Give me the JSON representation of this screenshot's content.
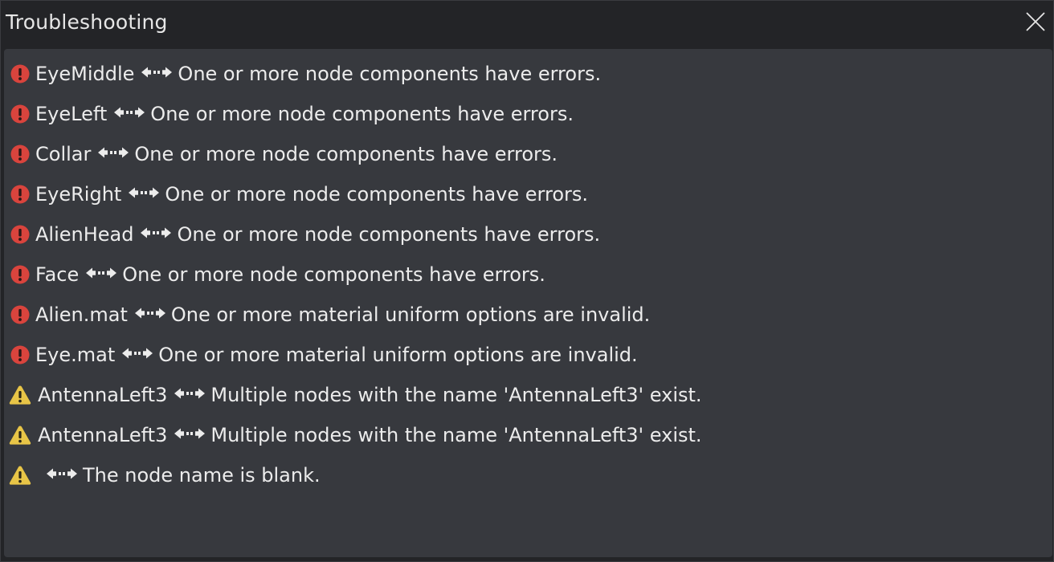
{
  "window": {
    "title": "Troubleshooting",
    "close_icon": "close-icon"
  },
  "colors": {
    "error": "#d9443d",
    "warning": "#e8c547",
    "panel_bg": "#37393e",
    "window_bg": "#232427",
    "text": "#ececec"
  },
  "issues": [
    {
      "severity": "error",
      "icon": "error-icon",
      "node": "EyeMiddle",
      "message": "One or more node components have errors."
    },
    {
      "severity": "error",
      "icon": "error-icon",
      "node": "EyeLeft",
      "message": "One or more node components have errors."
    },
    {
      "severity": "error",
      "icon": "error-icon",
      "node": "Collar",
      "message": "One or more node components have errors."
    },
    {
      "severity": "error",
      "icon": "error-icon",
      "node": "EyeRight",
      "message": "One or more node components have errors."
    },
    {
      "severity": "error",
      "icon": "error-icon",
      "node": "AlienHead",
      "message": "One or more node components have errors."
    },
    {
      "severity": "error",
      "icon": "error-icon",
      "node": "Face",
      "message": "One or more node components have errors."
    },
    {
      "severity": "error",
      "icon": "error-icon",
      "node": "Alien.mat",
      "message": "One or more material uniform options are invalid."
    },
    {
      "severity": "error",
      "icon": "error-icon",
      "node": "Eye.mat",
      "message": "One or more material uniform options are invalid."
    },
    {
      "severity": "warning",
      "icon": "warning-icon",
      "node": "AntennaLeft3",
      "message": "Multiple nodes with the name 'AntennaLeft3' exist."
    },
    {
      "severity": "warning",
      "icon": "warning-icon",
      "node": "AntennaLeft3",
      "message": "Multiple nodes with the name 'AntennaLeft3' exist."
    },
    {
      "severity": "warning",
      "icon": "warning-icon",
      "node": "",
      "message": "The node name is blank."
    }
  ]
}
